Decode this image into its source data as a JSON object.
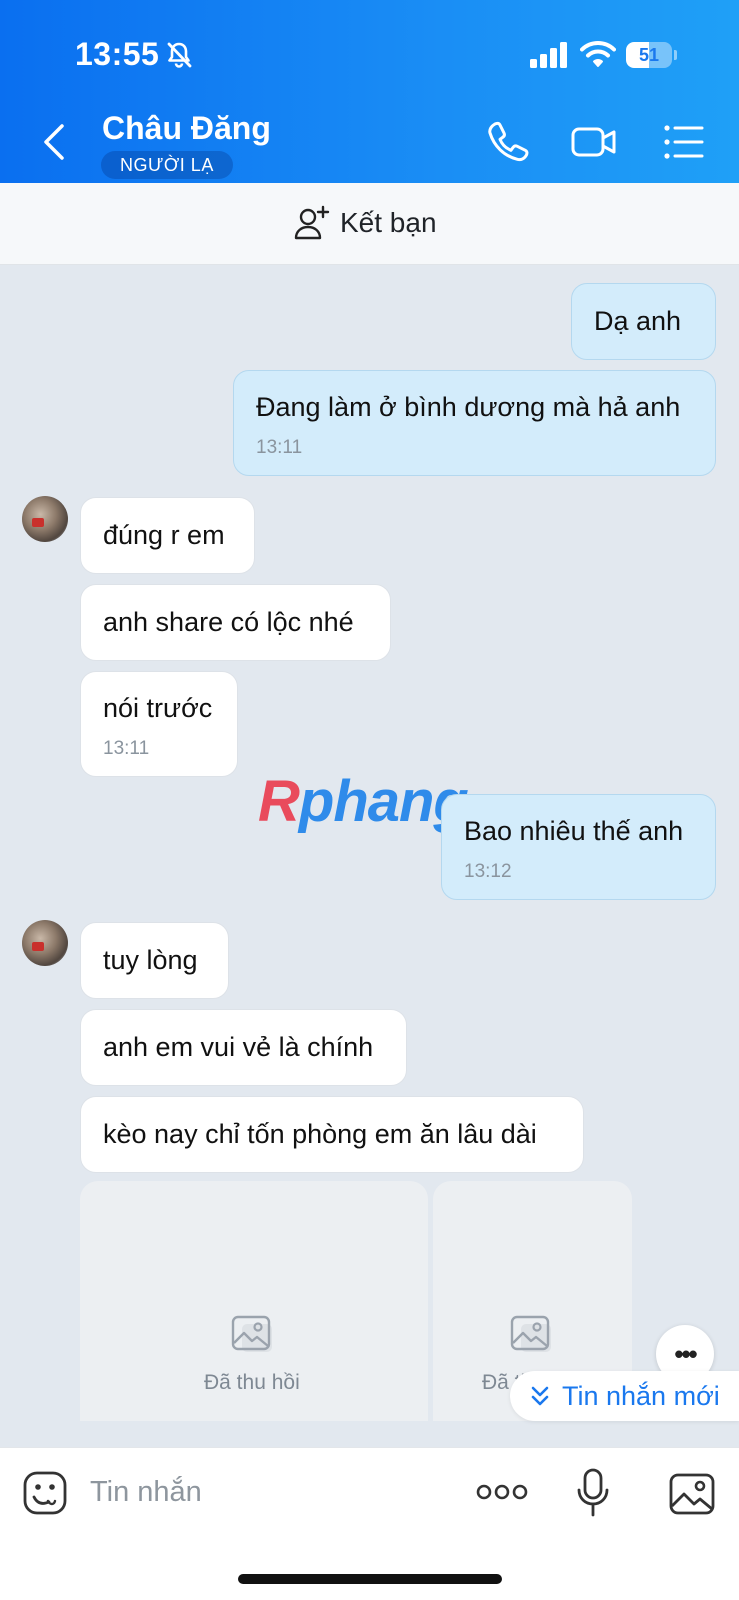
{
  "status_bar": {
    "time": "13:55",
    "battery": "51",
    "battery_level": 0.51
  },
  "header": {
    "contact_name": "Châu Đăng",
    "badge": "NGƯỜI LẠ"
  },
  "add_friend": {
    "label": "Kết bạn"
  },
  "messages": [
    {
      "text": "Dạ anh"
    },
    {
      "text": "Đang làm ở bình dương mà hả anh",
      "time": "13:11"
    },
    {
      "text": "đúng r em"
    },
    {
      "text": "anh share có lộc nhé"
    },
    {
      "text": "nói trước",
      "time": "13:11"
    },
    {
      "text": "Bao nhiêu thế anh",
      "time": "13:12"
    },
    {
      "text": "tuy lòng"
    },
    {
      "text": "anh em vui vẻ là chính"
    },
    {
      "text": "kèo nay chỉ tốn phòng em ăn lâu dài"
    }
  ],
  "recalled_media": [
    {
      "label": "Đã thu hồi"
    },
    {
      "label": "Đã thu hồi"
    }
  ],
  "watermark": {
    "first": "R",
    "rest": "phang"
  },
  "new_messages": {
    "label": "Tin nhắn mới"
  },
  "composer": {
    "placeholder": "Tin nhắn"
  }
}
